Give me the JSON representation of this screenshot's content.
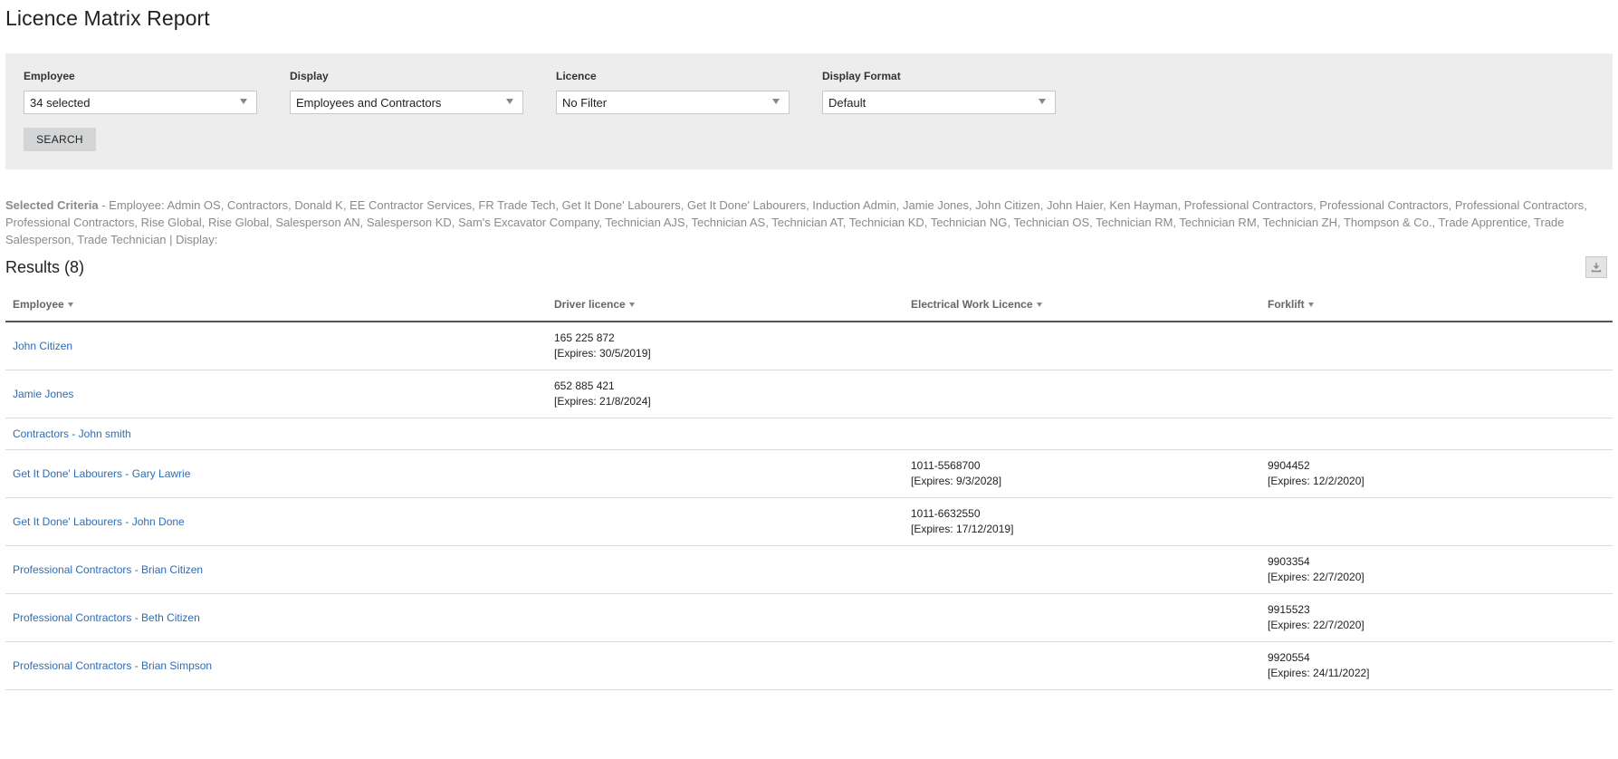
{
  "page": {
    "title": "Licence Matrix Report"
  },
  "filters": {
    "employee": {
      "label": "Employee",
      "value": "34 selected"
    },
    "display": {
      "label": "Display",
      "value": "Employees and Contractors"
    },
    "licence": {
      "label": "Licence",
      "value": "No Filter"
    },
    "display_format": {
      "label": "Display Format",
      "value": "Default"
    },
    "search_label": "SEARCH"
  },
  "criteria": {
    "label": "Selected Criteria",
    "text": " - Employee: Admin OS, Contractors, Donald K, EE Contractor Services, FR Trade Tech, Get It Done' Labourers, Get It Done' Labourers, Induction Admin, Jamie Jones, John Citizen, John Haier, Ken Hayman, Professional Contractors, Professional Contractors, Professional Contractors, Professional Contractors, Rise Global, Rise Global, Salesperson AN, Salesperson KD, Sam's Excavator Company, Technician AJS, Technician AS, Technician AT, Technician KD, Technician NG, Technician OS, Technician RM, Technician RM, Technician ZH, Thompson & Co., Trade Apprentice, Trade Salesperson, Trade Technician | Display:"
  },
  "results": {
    "title": "Results (8)",
    "export_icon": "download-icon",
    "columns": [
      "Employee",
      "Driver licence",
      "Electrical Work Licence",
      "Forklift"
    ],
    "rows": [
      {
        "employee": "John Citizen",
        "driver": {
          "number": "165 225 872",
          "expires": "[Expires: 30/5/2019]"
        },
        "electrical": null,
        "forklift": null
      },
      {
        "employee": "Jamie Jones",
        "driver": {
          "number": "652 885 421",
          "expires": "[Expires: 21/8/2024]"
        },
        "electrical": null,
        "forklift": null
      },
      {
        "employee": "Contractors - John smith",
        "driver": null,
        "electrical": null,
        "forklift": null
      },
      {
        "employee": "Get It Done' Labourers - Gary Lawrie",
        "driver": null,
        "electrical": {
          "number": "1011-5568700",
          "expires": "[Expires: 9/3/2028]"
        },
        "forklift": {
          "number": "9904452",
          "expires": "[Expires: 12/2/2020]"
        }
      },
      {
        "employee": "Get It Done' Labourers - John Done",
        "driver": null,
        "electrical": {
          "number": "1011-6632550",
          "expires": "[Expires: 17/12/2019]"
        },
        "forklift": null
      },
      {
        "employee": "Professional Contractors - Brian Citizen",
        "driver": null,
        "electrical": null,
        "forklift": {
          "number": "9903354",
          "expires": "[Expires: 22/7/2020]"
        }
      },
      {
        "employee": "Professional Contractors - Beth Citizen",
        "driver": null,
        "electrical": null,
        "forklift": {
          "number": "9915523",
          "expires": "[Expires: 22/7/2020]"
        }
      },
      {
        "employee": "Professional Contractors - Brian Simpson",
        "driver": null,
        "electrical": null,
        "forklift": {
          "number": "9920554",
          "expires": "[Expires: 24/11/2022]"
        }
      }
    ]
  },
  "colors": {
    "link": "#2d6db5",
    "panel": "#ededed",
    "muted": "#8a8a8a"
  }
}
